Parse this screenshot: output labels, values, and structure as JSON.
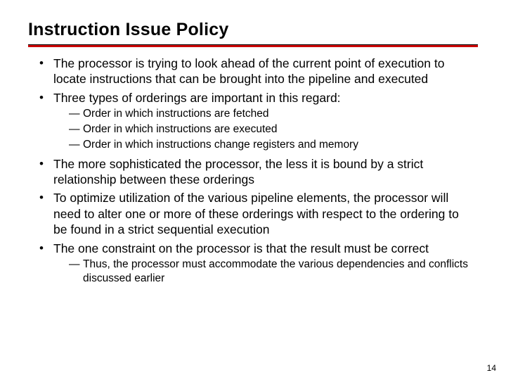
{
  "title": "Instruction Issue Policy",
  "bullets": {
    "b1": "The processor is trying to look ahead of the current point of execution to locate instructions that can be brought into the pipeline and executed",
    "b2": "Three types of orderings are important in this regard:",
    "b2sub": {
      "s1": "Order in which instructions are fetched",
      "s2": "Order in which instructions are executed",
      "s3": "Order in which instructions change registers and memory"
    },
    "b3": "The more sophisticated the processor, the less it is bound by a strict relationship between these orderings",
    "b4": "To optimize utilization of the various pipeline elements, the processor will need to alter one or more of these orderings with respect to the ordering to be found in a strict sequential execution",
    "b5": "The one constraint on the processor is that the result must be correct",
    "b5sub": {
      "s1": "Thus, the processor must accommodate the various dependencies and conflicts discussed earlier"
    }
  },
  "page_number": "14"
}
